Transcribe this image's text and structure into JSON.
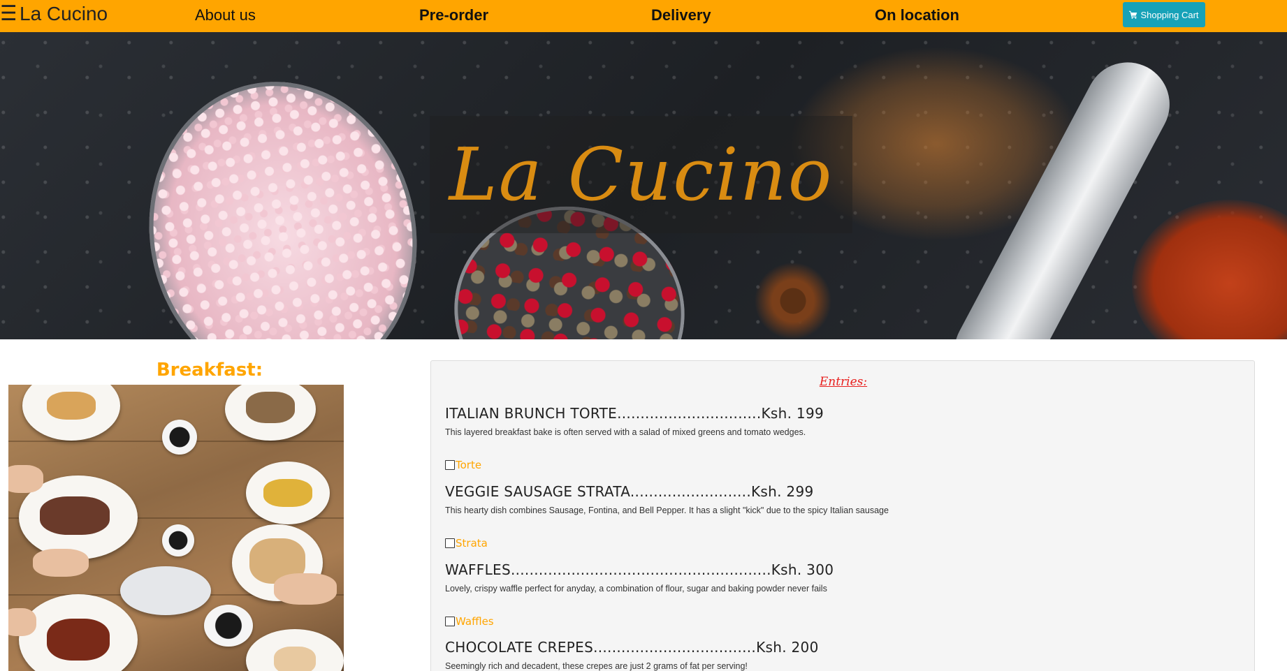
{
  "navbar": {
    "brand": "La Cucino",
    "hamburger_icon": "☰",
    "links": [
      "About us",
      "Pre-order",
      "Delivery",
      "On location"
    ],
    "cart_label": "Shopping Cart",
    "cart_icon": "shopping-cart-icon",
    "colors": {
      "bar": "#ffa500",
      "cart_button": "#17a2b8"
    }
  },
  "hero": {
    "title": "La Cucino",
    "title_color": "#d98c12"
  },
  "breakfast": {
    "heading": "Breakfast:"
  },
  "menu": {
    "subtitle": "Entries:",
    "items": [
      {
        "title": "ITALIAN BRUNCH TORTE...............................Ksh. 199",
        "description": "This layered breakfast bake is often served with a salad of mixed greens and tomato wedges.",
        "checkbox_label": "Torte"
      },
      {
        "title": "VEGGIE SAUSAGE STRATA..........................Ksh. 299",
        "description": "This hearty dish combines Sausage, Fontina, and Bell Pepper. It has a slight \"kick\" due to the spicy Italian sausage",
        "checkbox_label": "Strata"
      },
      {
        "title": "WAFFLES........................................................Ksh. 300",
        "description": "Lovely, crispy waffle perfect for anyday, a combination of flour, sugar and baking powder never fails",
        "checkbox_label": "Waffles"
      },
      {
        "title": "CHOCOLATE CREPES...................................Ksh. 200",
        "description": "Seemingly rich and decadent, these crepes are just 2 grams of fat per serving!"
      }
    ],
    "colors": {
      "subtitle": "#e8201e",
      "checkbox_label": "#ffa500"
    }
  }
}
